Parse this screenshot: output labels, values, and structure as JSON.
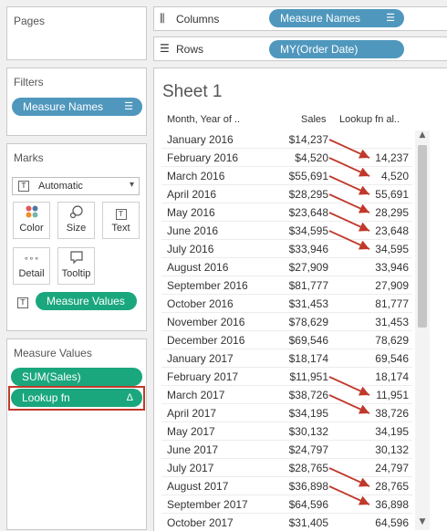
{
  "pages": {
    "title": "Pages"
  },
  "filters": {
    "title": "Filters",
    "pill": "Measure Names",
    "pill_icon": "filter-lines-icon"
  },
  "marks": {
    "title": "Marks",
    "type_select": "Automatic",
    "buttons": {
      "color": "Color",
      "size": "Size",
      "text": "Text",
      "detail": "Detail",
      "tooltip": "Tooltip"
    },
    "text_pill": "Measure Values"
  },
  "measure_values": {
    "title": "Measure Values",
    "items": [
      "SUM(Sales)",
      "Lookup fn"
    ],
    "lookup_delta": "Δ"
  },
  "columns_shelf": {
    "label": "Columns",
    "pill": "Measure Names"
  },
  "rows_shelf": {
    "label": "Rows",
    "pill": "MY(Order Date)"
  },
  "sheet": {
    "title": "Sheet 1",
    "headers": {
      "month": "Month, Year of ..",
      "sales": "Sales",
      "lookup": "Lookup fn al.."
    },
    "rows": [
      {
        "month": "January 2016",
        "sales": "$14,237",
        "lookup": ""
      },
      {
        "month": "February 2016",
        "sales": "$4,520",
        "lookup": "14,237"
      },
      {
        "month": "March 2016",
        "sales": "$55,691",
        "lookup": "4,520"
      },
      {
        "month": "April 2016",
        "sales": "$28,295",
        "lookup": "55,691"
      },
      {
        "month": "May 2016",
        "sales": "$23,648",
        "lookup": "28,295"
      },
      {
        "month": "June 2016",
        "sales": "$34,595",
        "lookup": "23,648"
      },
      {
        "month": "July 2016",
        "sales": "$33,946",
        "lookup": "34,595"
      },
      {
        "month": "August 2016",
        "sales": "$27,909",
        "lookup": "33,946"
      },
      {
        "month": "September 2016",
        "sales": "$81,777",
        "lookup": "27,909"
      },
      {
        "month": "October 2016",
        "sales": "$31,453",
        "lookup": "81,777"
      },
      {
        "month": "November 2016",
        "sales": "$78,629",
        "lookup": "31,453"
      },
      {
        "month": "December 2016",
        "sales": "$69,546",
        "lookup": "78,629"
      },
      {
        "month": "January 2017",
        "sales": "$18,174",
        "lookup": "69,546"
      },
      {
        "month": "February 2017",
        "sales": "$11,951",
        "lookup": "18,174"
      },
      {
        "month": "March 2017",
        "sales": "$38,726",
        "lookup": "11,951"
      },
      {
        "month": "April 2017",
        "sales": "$34,195",
        "lookup": "38,726"
      },
      {
        "month": "May 2017",
        "sales": "$30,132",
        "lookup": "34,195"
      },
      {
        "month": "June 2017",
        "sales": "$24,797",
        "lookup": "30,132"
      },
      {
        "month": "July 2017",
        "sales": "$28,765",
        "lookup": "24,797"
      },
      {
        "month": "August 2017",
        "sales": "$36,898",
        "lookup": "28,765"
      },
      {
        "month": "September 2017",
        "sales": "$64,596",
        "lookup": "36,898"
      },
      {
        "month": "October 2017",
        "sales": "$31,405",
        "lookup": "64,596"
      }
    ],
    "arrow_rows": [
      0,
      1,
      2,
      3,
      4,
      5,
      13,
      14,
      18,
      19
    ]
  },
  "colors": {
    "blue_pill": "#4f97bd",
    "green_pill": "#1aa77d",
    "arrow": "#c0392b",
    "highlight": "#c0392b"
  }
}
